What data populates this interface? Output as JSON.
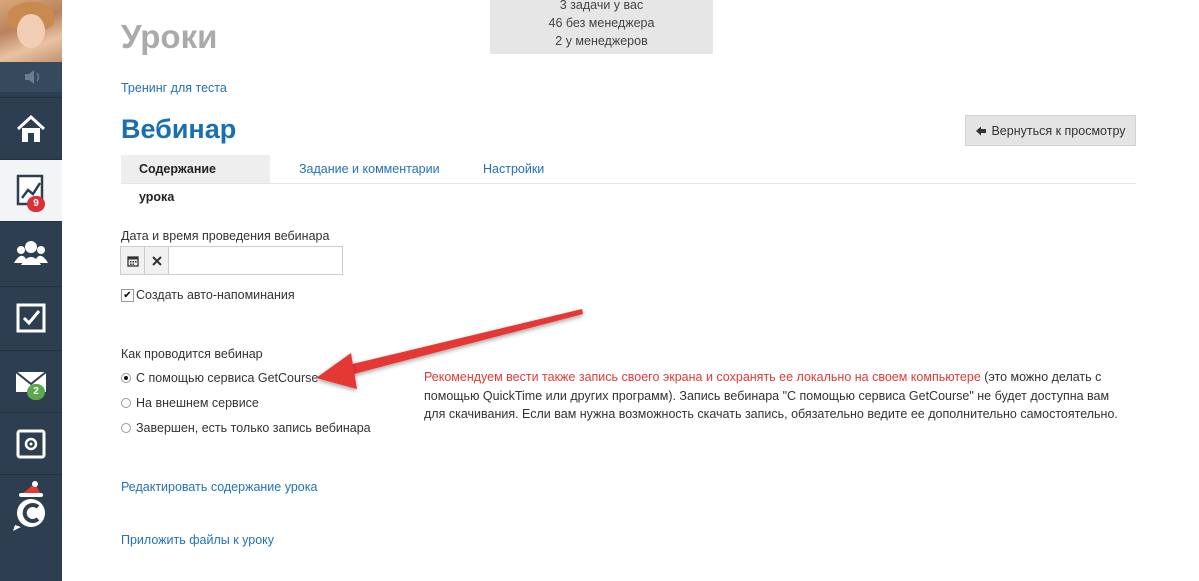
{
  "sidebar": {
    "items": [
      {
        "name": "home",
        "icon": "home-icon"
      },
      {
        "name": "analytics",
        "icon": "chart-icon",
        "badge": "9",
        "active": true
      },
      {
        "name": "users",
        "icon": "users-icon"
      },
      {
        "name": "tasks",
        "icon": "checkbox-icon"
      },
      {
        "name": "messages",
        "icon": "envelope-icon",
        "badge": "2"
      },
      {
        "name": "safe",
        "icon": "safe-icon"
      },
      {
        "name": "getcourse",
        "icon": "getcourse-logo-icon"
      }
    ]
  },
  "topbox": {
    "line1": "3 задачи у вас",
    "line2": "46 без менеджера",
    "line3": "2 у менеджеров"
  },
  "header": {
    "title": "Уроки",
    "breadcrumb": "Тренинг для теста",
    "lesson_title": "Вебинар",
    "back_button": "Вернуться к просмотру"
  },
  "tabs": [
    {
      "label": "Содержание урока",
      "active": true
    },
    {
      "label": "Задание и комментарии"
    },
    {
      "label": "Настройки"
    }
  ],
  "form": {
    "datetime_label": "Дата и время проведения вебинара",
    "datetime_value": "",
    "auto_reminder_label": "Создать авто-напоминания",
    "auto_reminder_checked": true,
    "mode_label": "Как проводится вебинар",
    "options": [
      {
        "label": "С помощью сервиса GetCourse",
        "selected": true
      },
      {
        "label": "На внешнем сервисе",
        "selected": false
      },
      {
        "label": "Завершен, есть только запись вебинара",
        "selected": false
      }
    ]
  },
  "note": {
    "highlight": "Рекомендуем вести также запись своего экрана и сохранять ее локально на своем компьютере",
    "rest": " (это можно делать с помощью QuickTime или других программ). Запись вебинара \"С помощью сервиса GetCourse\" не будет доступна вам для скачивания. Если вам нужна возможность скачать запись, обязательно ведите ее дополнительно самостоятельно."
  },
  "links": {
    "edit_content": "Редактировать содержание урока",
    "attach_files": "Приложить файлы к уроку"
  },
  "colors": {
    "sidebar": "#2c3e50",
    "link": "#2272b8",
    "title": "#1a6fb2",
    "warning": "#e53935",
    "arrow": "#e53935"
  }
}
